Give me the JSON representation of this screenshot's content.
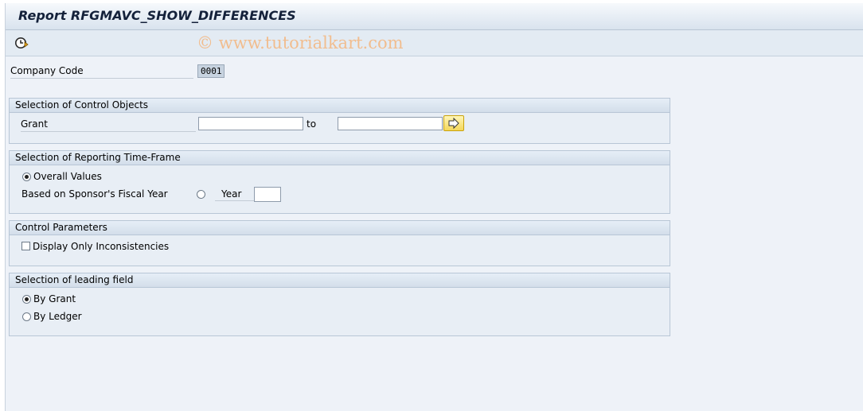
{
  "window": {
    "title": "Report RFGMAVC_SHOW_DIFFERENCES"
  },
  "toolbar": {
    "execute_icon": "execute-clock-icon",
    "watermark": "© www.tutorialkart.com"
  },
  "company_code": {
    "label": "Company Code",
    "value": "0001"
  },
  "control_objects": {
    "title": "Selection of Control Objects",
    "grant_label": "Grant",
    "grant_from": "",
    "to_label": "to",
    "grant_to": "",
    "multiple_selection_icon": "arrow-right-icon"
  },
  "time_frame": {
    "title": "Selection of  Reporting Time-Frame",
    "overall_label": "Overall Values",
    "overall_selected": true,
    "fiscal_label": "Based on Sponsor's Fiscal Year",
    "fiscal_selected": false,
    "year_label": "Year",
    "year_value": ""
  },
  "control_params": {
    "title": "Control Parameters",
    "inconsistencies_label": "Display Only Inconsistencies",
    "inconsistencies_checked": false
  },
  "leading_field": {
    "title": "Selection of leading field",
    "by_grant_label": "By Grant",
    "by_grant_selected": true,
    "by_ledger_label": "By Ledger",
    "by_ledger_selected": false
  }
}
